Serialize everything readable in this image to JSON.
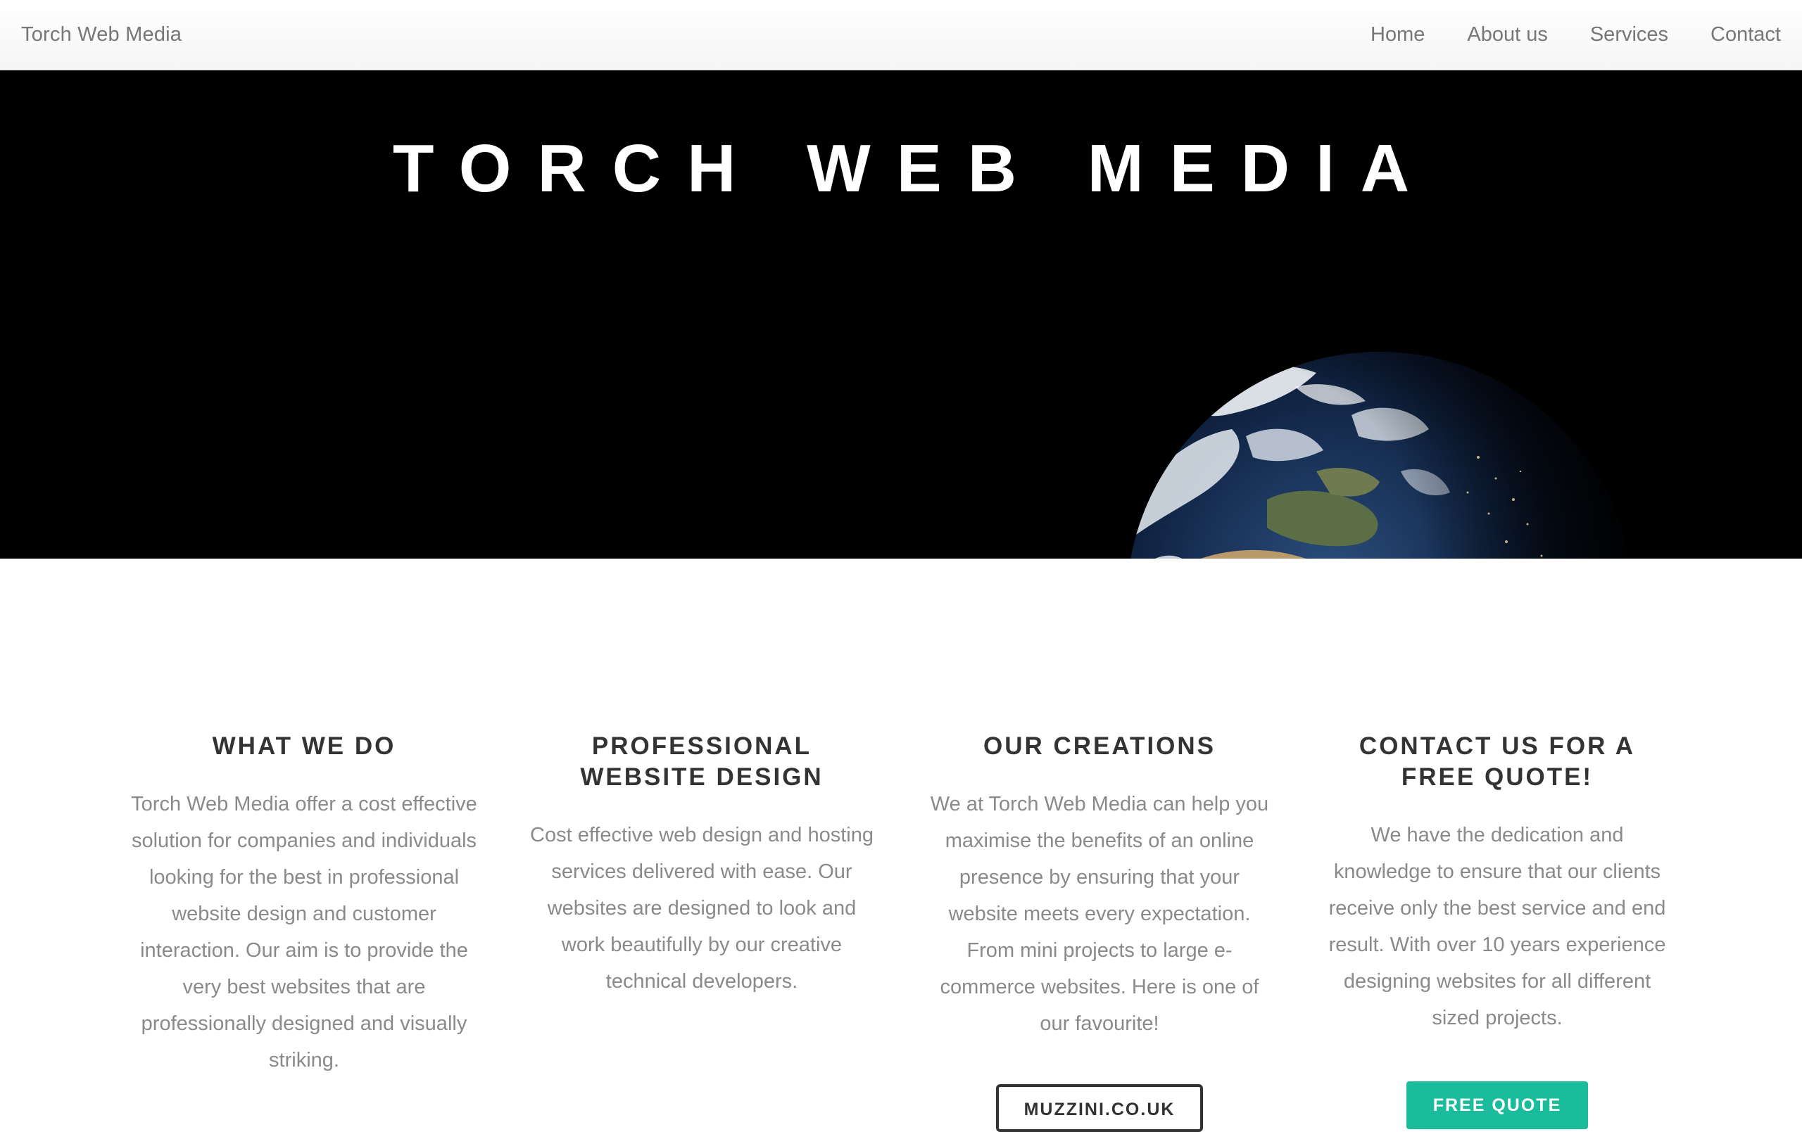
{
  "navbar": {
    "brand": "Torch Web Media",
    "links": [
      "Home",
      "About us",
      "Services",
      "Contact"
    ]
  },
  "hero": {
    "title": "TORCH WEB MEDIA"
  },
  "columns": [
    {
      "heading": "WHAT WE DO",
      "body": "Torch Web Media offer a cost effective solution for companies and individuals looking for the best in professional website design and customer interaction. Our aim is to provide the very best websites that are professionally designed and visually striking."
    },
    {
      "heading": "PROFESSIONAL WEBSITE DESIGN",
      "body": "Cost effective web design and hosting services delivered with ease. Our websites are designed to look and work beautifully by our creative technical developers."
    },
    {
      "heading": "OUR CREATIONS",
      "body": "We at Torch Web Media can help you maximise the benefits of an online presence by ensuring that your website meets every expectation. From mini projects to large e-commerce websites. Here is one of our favourite!",
      "button": "MUZZINI.CO.UK"
    },
    {
      "heading": "CONTACT US FOR A FREE QUOTE!",
      "body": "We have the dedication and knowledge to ensure that our clients receive only the best service and end result. With over 10 years experience designing websites for all different sized projects.",
      "button": "FREE QUOTE"
    }
  ],
  "colors": {
    "accent": "#1abc9c",
    "heading": "#333333",
    "body_text": "#8a8a8a",
    "hero_bg": "#000000"
  }
}
